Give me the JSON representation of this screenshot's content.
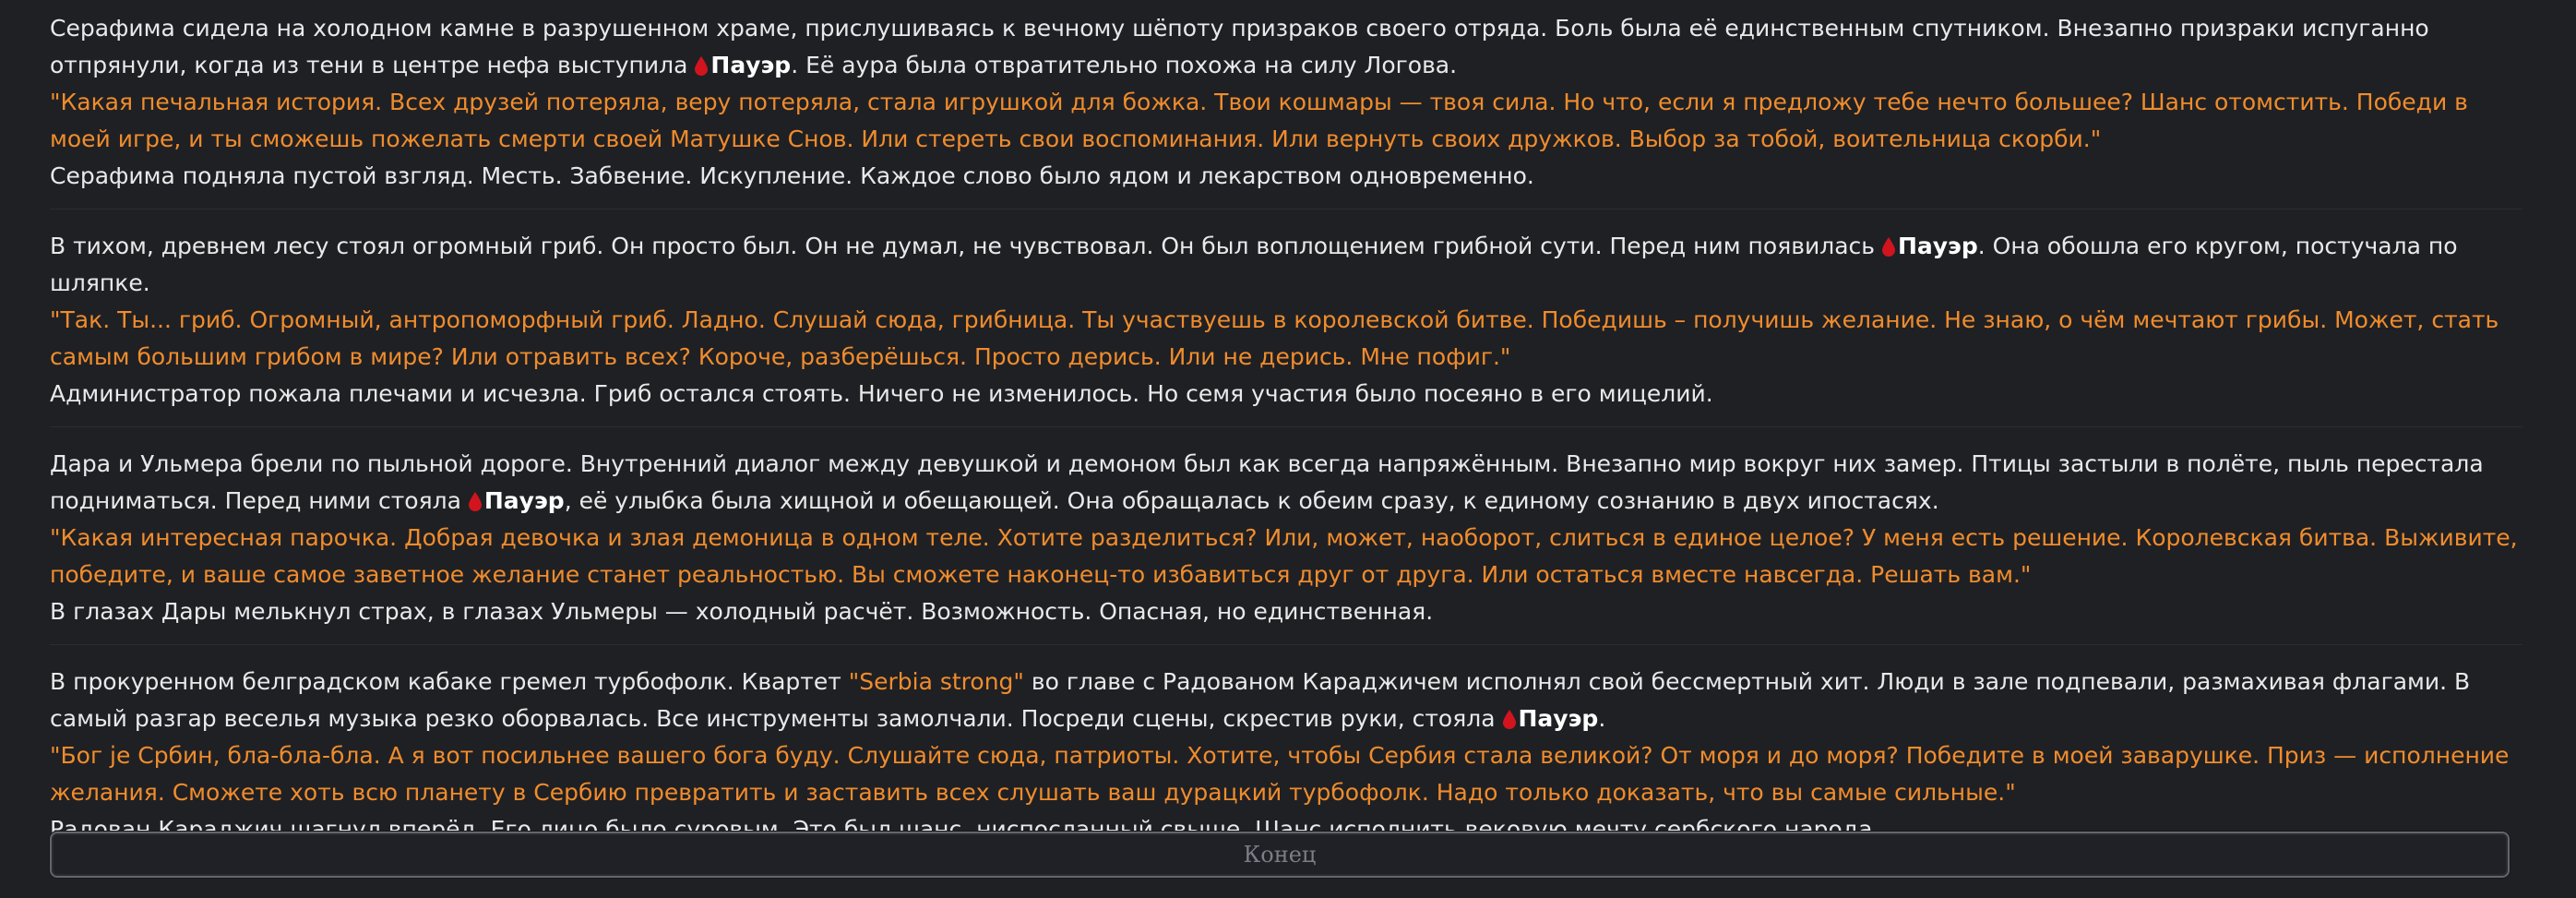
{
  "icons": {
    "character_marker": "blood-drop-icon",
    "marker_color": "#d2141e"
  },
  "colors": {
    "speech": "#f08c2c",
    "narration": "#e9e9ea",
    "background": "#1f2024"
  },
  "stories": [
    {
      "intro_pre": "Серафима сидела на холодном камне в разрушенном храме, прислушиваясь к вечному шёпоту призраков своего отряда. Боль была её единственным спутником. Внезапно призраки испуганно отпрянули, когда из тени в центре нефа выступила ",
      "name": "Пауэр",
      "intro_post": ". Её аура была отвратительно похожа на силу Логова.",
      "speech": "\"Какая печальная история. Всех друзей потеряла, веру потеряла, стала игрушкой для божка. Твои кошмары — твоя сила. Но что, если я предложу тебе нечто большее? Шанс отомстить. Победи в моей игре, и ты сможешь пожелать смерти своей Матушке Снов. Или стереть свои воспоминания. Или вернуть своих дружков. Выбор за тобой, воительница скорби.\"",
      "outro": "Серафима подняла пустой взгляд. Месть. Забвение. Искупление. Каждое слово было ядом и лекарством одновременно."
    },
    {
      "intro_pre": "В тихом, древнем лесу стоял огромный гриб. Он просто был. Он не думал, не чувствовал. Он был воплощением грибной сути. Перед ним появилась ",
      "name": "Пауэр",
      "intro_post": ". Она обошла его кругом, постучала по шляпке.",
      "speech": "\"Так. Ты... гриб. Огромный, антропоморфный гриб. Ладно. Слушай сюда, грибница. Ты участвуешь в королевской битве. Победишь – получишь желание. Не знаю, о чём мечтают грибы. Может, стать самым большим грибом в мире? Или отравить всех? Короче, разберёшься. Просто дерись. Или не дерись. Мне пофиг.\"",
      "outro": "Администратор пожала плечами и исчезла. Гриб остался стоять. Ничего не изменилось. Но семя участия было посеяно в его мицелий."
    },
    {
      "intro_pre": "Дара и Ульмера брели по пыльной дороге. Внутренний диалог между девушкой и демоном был как всегда напряжённым. Внезапно мир вокруг них замер. Птицы застыли в полёте, пыль перестала подниматься. Перед ними стояла ",
      "name": "Пауэр",
      "intro_post": ", её улыбка была хищной и обещающей. Она обращалась к обеим сразу, к единому сознанию в двух ипостасях.",
      "speech": "\"Какая интересная парочка. Добрая девочка и злая демоница в одном теле. Хотите разделиться? Или, может, наоборот, слиться в единое целое? У меня есть решение. Королевская битва. Выживите, победите, и ваше самое заветное желание станет реальностью. Вы сможете наконец-то избавиться друг от друга. Или остаться вместе навсегда. Решать вам.\"",
      "outro": "В глазах Дары мелькнул страх, в глазах Ульмеры — холодный расчёт. Возможность. Опасная, но единственная."
    },
    {
      "intro_pre": "В прокуренном белградском кабаке гремел турбофолк. Квартет ",
      "highlight": "\"Serbia strong\"",
      "intro_mid": " во главе с Радованом Караджичем исполнял свой бессмертный хит. Люди в зале подпевали, размахивая флагами. В самый разгар веселья музыка резко оборвалась. Все инструменты замолчали. Посреди сцены, скрестив руки, стояла ",
      "name": "Пауэр",
      "intro_post": ".",
      "speech": "\"Бог је Србин, бла-бла-бла. А я вот посильнее вашего бога буду. Слушайте сюда, патриоты. Хотите, чтобы Сербия стала великой? От моря и до моря? Победите в моей заварушке. Приз — исполнение желания. Сможете хоть всю планету в Сербию превратить и заставить всех слушать ваш дурацкий турбофолк. Надо только доказать, что вы самые сильные.\"",
      "outro": "Радован Караджич шагнул вперёд. Его лицо было суровым. Это был шанс, ниспосланный свыше. Шанс исполнить вековую мечту сербского народа."
    }
  ],
  "end_button": {
    "label": "Конец"
  }
}
